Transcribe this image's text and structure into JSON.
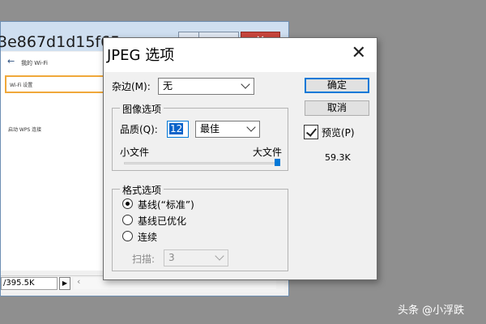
{
  "background_window": {
    "title": "3e867d1d15f65……",
    "wifi_back_arrow": "←",
    "wifi_title": "我的 Wi-Fi",
    "wifi_setting": "Wi-Fi 设置",
    "wps_link": "启动 WPS 连接",
    "status_size": "/395.5K",
    "play_glyph": "▶",
    "scroll_left_glyph": "‹"
  },
  "dialog": {
    "title": "JPEG 选项",
    "close_glyph": "✕",
    "matte": {
      "label": "杂边(M):",
      "value": "无"
    },
    "image_options": {
      "title": "图像选项",
      "quality_label": "品质(Q):",
      "quality_value": "12",
      "quality_preset": "最佳",
      "small_file": "小文件",
      "large_file": "大文件",
      "slider_fraction": 1.0
    },
    "format_options": {
      "title": "格式选项",
      "baseline_standard": "基线(“标准”)",
      "baseline_optimized": "基线已优化",
      "progressive": "连续",
      "scans_label": "扫描:",
      "scans_value": "3",
      "selected": "baseline_standard"
    },
    "ok_label": "确定",
    "cancel_label": "取消",
    "preview_label": "预览(P)",
    "preview_checked": true,
    "file_size": "59.3K"
  },
  "watermark": "头条 @小浮跌",
  "colors": {
    "accent": "#0078d7",
    "close_button": "#c9463d",
    "highlight_border": "#f0a83a"
  }
}
